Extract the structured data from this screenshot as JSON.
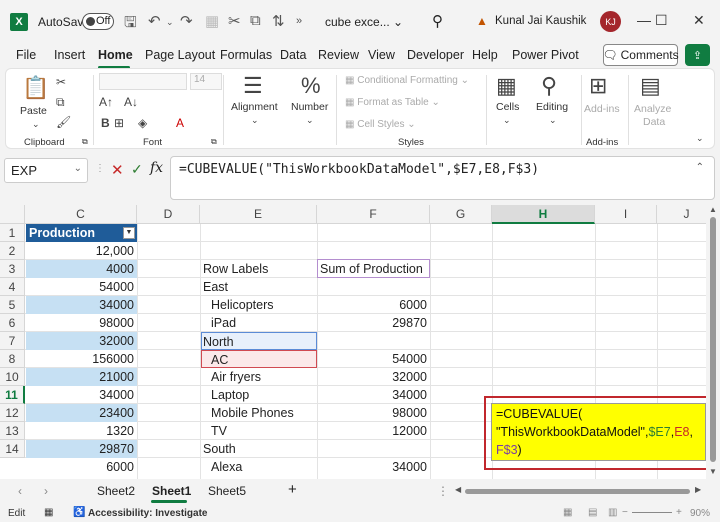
{
  "titlebar": {
    "logo": "X",
    "autosave_label": "AutoSave",
    "autosave_state": "Off",
    "doc_title": "cube exce... ⌄",
    "user_name": "Kunal Jai Kaushik",
    "user_initials": "KJ"
  },
  "menu": {
    "items": [
      "File",
      "Insert",
      "Home",
      "Page Layout",
      "Formulas",
      "Data",
      "Review",
      "View",
      "Developer",
      "Help",
      "Power Pivot"
    ],
    "active": "Home",
    "comments_label": "Comments"
  },
  "ribbon": {
    "paste_label": "Paste",
    "clipboard_label": "Clipboard",
    "font_label": "Font",
    "font_size": "14",
    "alignment_label": "Alignment",
    "number_label": "Number",
    "conditional_formatting": "Conditional Formatting",
    "format_as_table": "Format as Table",
    "cell_styles": "Cell Styles",
    "styles_label": "Styles",
    "cells_label": "Cells",
    "editing_label": "Editing",
    "addins_label": "Add-ins",
    "addins_group_label": "Add-ins",
    "analyze_data_line1": "Analyze",
    "analyze_data_line2": "Data"
  },
  "formula_bar": {
    "name_box": "EXP",
    "formula": "=CUBEVALUE(\"ThisWorkbookDataModel\",$E7,E8,F$3)"
  },
  "columns": [
    "C",
    "D",
    "E",
    "F",
    "G",
    "H",
    "I",
    "J"
  ],
  "rows": [
    "1",
    "2",
    "3",
    "4",
    "5",
    "6",
    "7",
    "8",
    "10",
    "11",
    "12",
    "13",
    "14"
  ],
  "column_c": {
    "header": "Production",
    "values": [
      "12,000",
      "4000",
      "54000",
      "34000",
      "98000",
      "32000",
      "156000",
      "21000",
      "34000",
      "23400",
      "1320",
      "29870",
      "6000"
    ]
  },
  "pivot": {
    "row_labels_header": "Row Labels",
    "sum_header": "Sum of Production",
    "rows": [
      {
        "label": "East",
        "value": ""
      },
      {
        "label": "Helicopters",
        "value": "6000"
      },
      {
        "label": "iPad",
        "value": "29870"
      },
      {
        "label": "North",
        "value": ""
      },
      {
        "label": "AC",
        "value": "54000"
      },
      {
        "label": "Air fryers",
        "value": "32000"
      },
      {
        "label": "Laptop",
        "value": "34000"
      },
      {
        "label": "Mobile Phones",
        "value": "98000"
      },
      {
        "label": "TV",
        "value": "12000"
      },
      {
        "label": "South",
        "value": ""
      },
      {
        "label": "Alexa",
        "value": "34000"
      }
    ]
  },
  "popup": {
    "line1": "=CUBEVALUE(",
    "line2_text": "\"ThisWorkbookDataModel\",",
    "line2_ref1": "$E7",
    "line2_sep": ",",
    "line2_ref2": "E8",
    "line2_end": ",",
    "line3_ref": "F$3",
    "line3_end": ")"
  },
  "tabs": {
    "items": [
      "Sheet2",
      "Sheet1",
      "Sheet5"
    ],
    "active": "Sheet1",
    "add": "+"
  },
  "status": {
    "mode": "Edit",
    "accessibility": "Accessibility: Investigate",
    "zoom": "90%"
  }
}
